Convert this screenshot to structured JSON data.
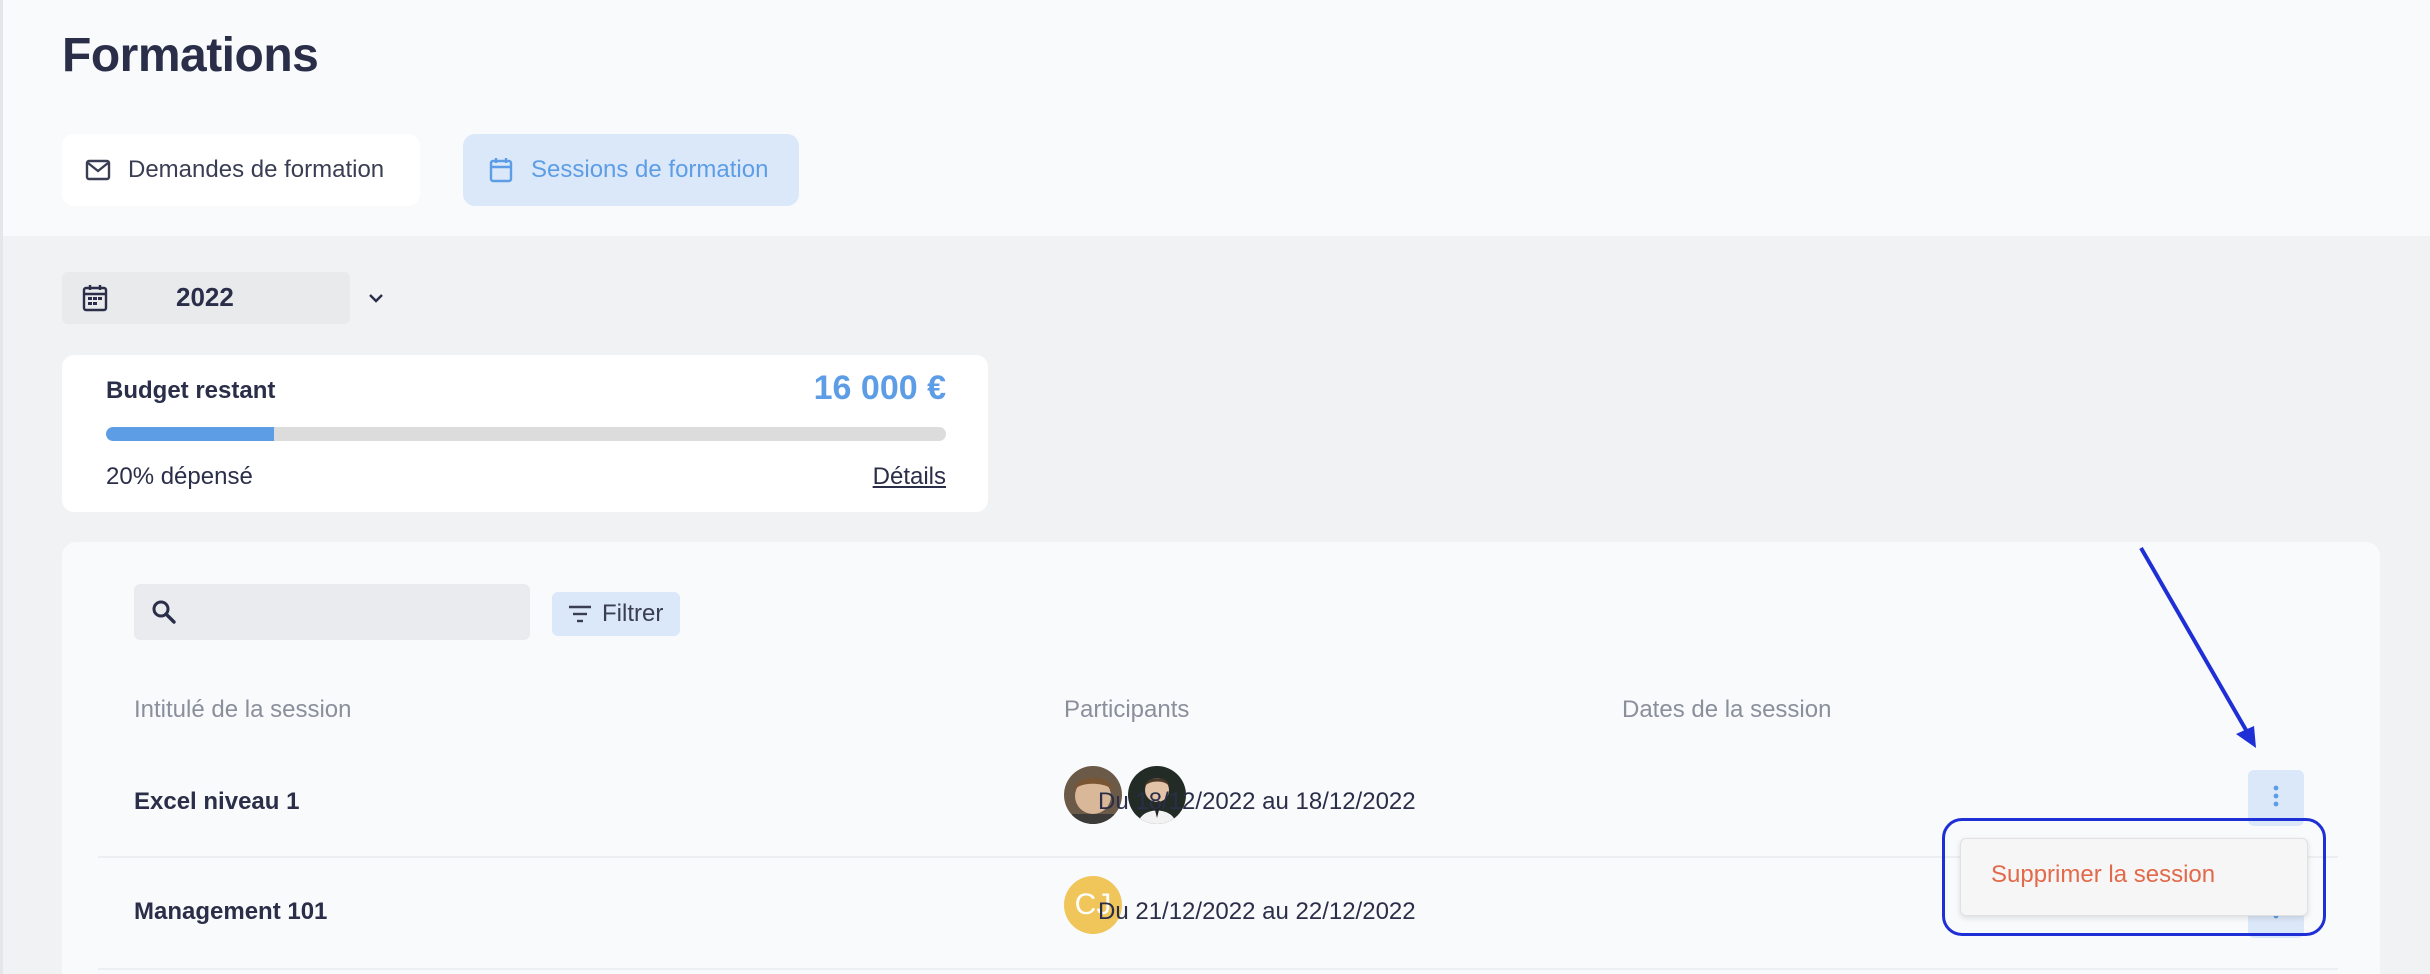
{
  "page": {
    "title": "Formations"
  },
  "tabs": [
    {
      "label": "Demandes de formation",
      "icon": "mail-icon",
      "active": false
    },
    {
      "label": "Sessions de formation",
      "icon": "calendar-icon",
      "active": true
    }
  ],
  "year_filter": {
    "value": "2022",
    "icon": "calendar-icon"
  },
  "budget": {
    "label": "Budget restant",
    "amount": "16 000 €",
    "spent_label": "20% dépensé",
    "spent_fraction": 0.2,
    "details_label": "Détails"
  },
  "toolbar": {
    "search_placeholder": "",
    "filter_label": "Filtrer"
  },
  "table": {
    "columns": [
      "Intitulé de la session",
      "Participants",
      "Dates de la session"
    ],
    "rows": [
      {
        "title": "Excel niveau 1",
        "participants": [
          {
            "type": "photo"
          },
          {
            "type": "photo"
          }
        ],
        "dates": "Du 18/12/2022 au 18/12/2022"
      },
      {
        "title": "Management 101",
        "participants": [
          {
            "type": "initials",
            "initials": "CJ"
          }
        ],
        "dates": "Du 21/12/2022 au 22/12/2022"
      }
    ]
  },
  "row_menu": {
    "items": [
      "Supprimer la session"
    ]
  },
  "colors": {
    "accent": "#5d9de6",
    "accent_bg": "#dbe8f9",
    "danger": "#e2694a",
    "annotation": "#1f2fd6",
    "text": "#2a2e48"
  }
}
